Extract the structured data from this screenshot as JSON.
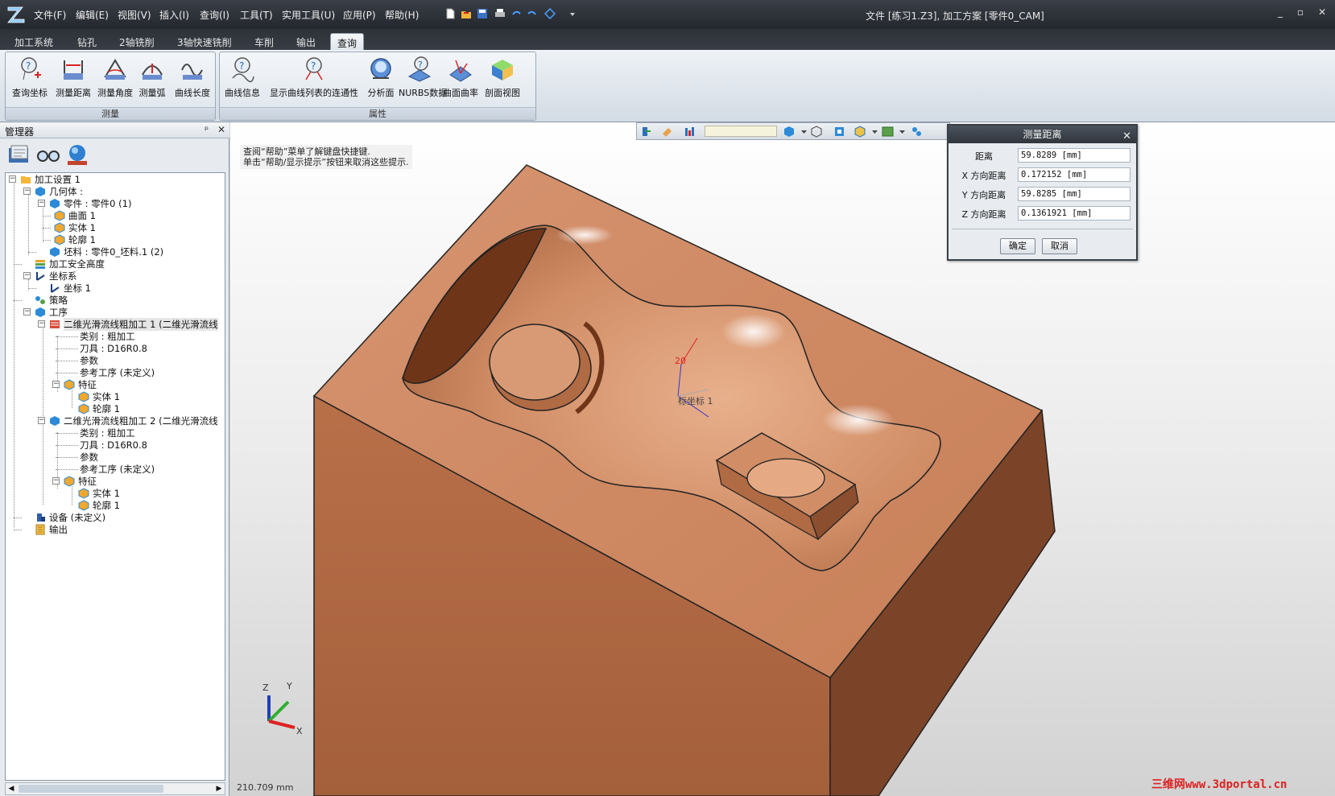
{
  "titlebar": {
    "menus": [
      "文件(F)",
      "编辑(E)",
      "视图(V)",
      "插入(I)",
      "查询(I)",
      "工具(T)",
      "实用工具(U)",
      "应用(P)",
      "帮助(H)"
    ],
    "title": "文件 [练习1.Z3], 加工方案 [零件0_CAM]"
  },
  "tabs": [
    "加工系统",
    "钻孔",
    "2轴铣削",
    "3轴快速铣削",
    "车削",
    "输出",
    "查询"
  ],
  "active_tab": "查询",
  "ribbon": {
    "measure_group": {
      "label": "测量",
      "buttons": [
        "查询坐标",
        "测量距离",
        "测量角度",
        "测量弧",
        "曲线长度"
      ]
    },
    "attr_group": {
      "label": "属性",
      "buttons": [
        "曲线信息",
        "显示曲线列表的连通性",
        "分析面",
        "NURBS数据",
        "曲面曲率",
        "剖面视图"
      ]
    }
  },
  "manager": {
    "title": "管理器",
    "pin": "ᵖ",
    "close": "✕",
    "tree": [
      "加工设置 1",
      "几何体 :",
      "零件 : 零件0 (1)",
      "曲面 1",
      "实体 1",
      "轮廓 1",
      "坯料 : 零件0_坯料.1 (2)",
      "加工安全高度",
      "坐标系",
      "坐标 1",
      "策略",
      "工序",
      "二维光滑流线粗加工 1 (二维光滑流线",
      "类别 : 粗加工",
      "刀具 : D16R0.8",
      "参数",
      "参考工序 (未定义)",
      "特征",
      "实体 1",
      "轮廓 1",
      "二维光滑流线粗加工 2 (二维光滑流线",
      "类别 : 粗加工",
      "刀具 : D16R0.8",
      "参数",
      "参考工序 (未定义)",
      "特征",
      "实体 1",
      "轮廓 1",
      "设备 (未定义)",
      "输出"
    ]
  },
  "viewport": {
    "hint_line1": "查阅“帮助”菜单了解键盘快捷键.",
    "hint_line2": "单击“帮助/显示提示”按钮来取消这些提示.",
    "csys_label": "标坐标 1",
    "csys_z_tick": "20",
    "triad": {
      "x": "X",
      "y": "Y",
      "z": "Z"
    },
    "coords": "210.709 mm",
    "watermark": "三维网www.3dportal.cn"
  },
  "dialog": {
    "title": "测量距离",
    "close": "✕",
    "rows": [
      {
        "label": "距离",
        "value": "59.8289 [mm]"
      },
      {
        "label": "X 方向距离",
        "value": "0.172152 [mm]"
      },
      {
        "label": "Y 方向距离",
        "value": "59.8285 [mm]"
      },
      {
        "label": "Z 方向距离",
        "value": "0.1361921 [mm]"
      }
    ],
    "ok": "确定",
    "cancel": "取消"
  },
  "colors": {
    "model_top": "#cd8a63",
    "model_front": "#a6653f",
    "model_side": "#7a4326",
    "cavity": "#d89a74",
    "chrome_dark": "#2b2f36"
  }
}
